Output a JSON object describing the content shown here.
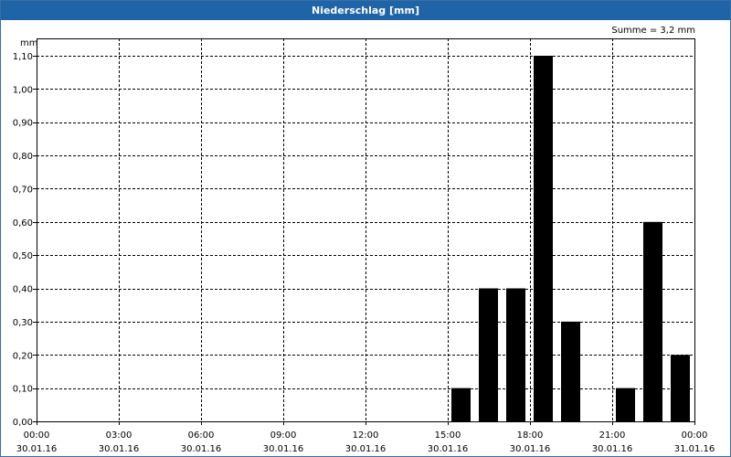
{
  "window": {
    "title": "Niederschlag [mm]"
  },
  "chart_data": {
    "type": "bar",
    "title": "Niederschlag [mm]",
    "ylabel": "mm",
    "annotation": "Summe = 3,2 mm",
    "ylim": [
      0,
      1.1
    ],
    "xlim_hours": [
      0,
      24
    ],
    "grid": true,
    "y_ticks": [
      {
        "value": 0.0,
        "label": "0,00"
      },
      {
        "value": 0.1,
        "label": "0,10"
      },
      {
        "value": 0.2,
        "label": "0,20"
      },
      {
        "value": 0.3,
        "label": "0,30"
      },
      {
        "value": 0.4,
        "label": "0,40"
      },
      {
        "value": 0.5,
        "label": "0,50"
      },
      {
        "value": 0.6,
        "label": "0,60"
      },
      {
        "value": 0.7,
        "label": "0,70"
      },
      {
        "value": 0.8,
        "label": "0,80"
      },
      {
        "value": 0.9,
        "label": "0,90"
      },
      {
        "value": 1.0,
        "label": "1,00"
      },
      {
        "value": 1.1,
        "label": "1,10"
      }
    ],
    "x_ticks": [
      {
        "hour": 0,
        "time": "00:00",
        "date": "30.01.16"
      },
      {
        "hour": 3,
        "time": "03:00",
        "date": "30.01.16"
      },
      {
        "hour": 6,
        "time": "06:00",
        "date": "30.01.16"
      },
      {
        "hour": 9,
        "time": "09:00",
        "date": "30.01.16"
      },
      {
        "hour": 12,
        "time": "12:00",
        "date": "30.01.16"
      },
      {
        "hour": 15,
        "time": "15:00",
        "date": "30.01.16"
      },
      {
        "hour": 18,
        "time": "18:00",
        "date": "30.01.16"
      },
      {
        "hour": 21,
        "time": "21:00",
        "date": "30.01.16"
      },
      {
        "hour": 24,
        "time": "00:00",
        "date": "31.01.16"
      }
    ],
    "bars": [
      {
        "hour": 15,
        "value": 0.1
      },
      {
        "hour": 16,
        "value": 0.4
      },
      {
        "hour": 17,
        "value": 0.4
      },
      {
        "hour": 18,
        "value": 1.1
      },
      {
        "hour": 19,
        "value": 0.3
      },
      {
        "hour": 21,
        "value": 0.1
      },
      {
        "hour": 22,
        "value": 0.6
      },
      {
        "hour": 23,
        "value": 0.2
      }
    ],
    "colors": {
      "bar": "#000000",
      "grid": "#000000",
      "titlebar": "#1e64a6"
    }
  }
}
